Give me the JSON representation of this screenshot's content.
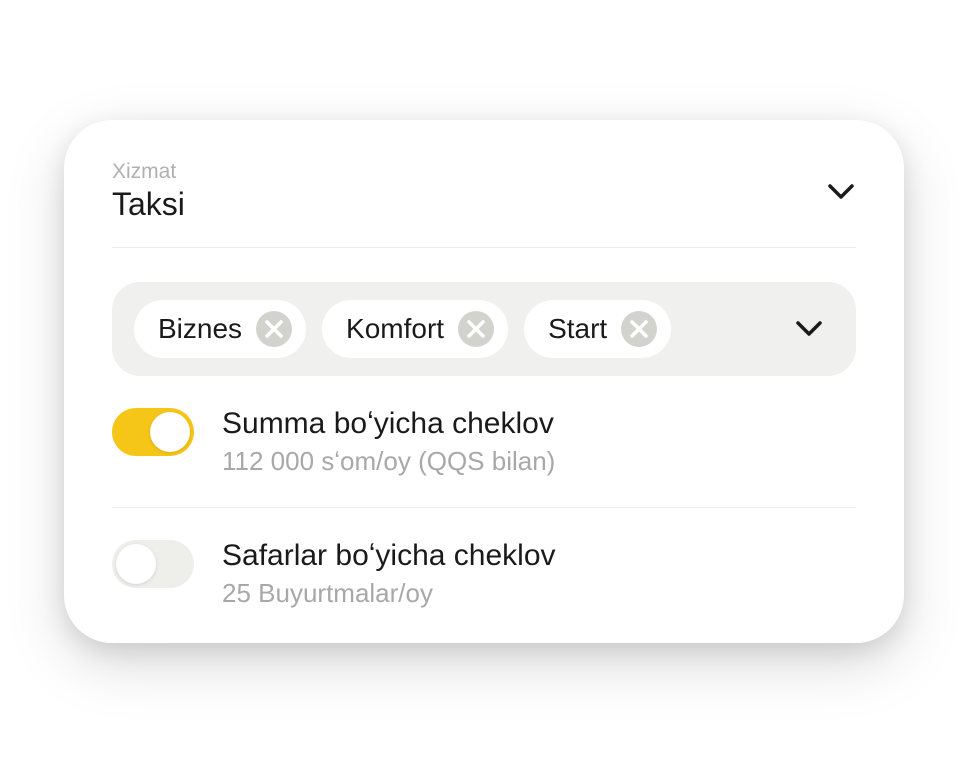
{
  "service": {
    "label": "Xizmat",
    "value": "Taksi"
  },
  "tags": [
    {
      "label": "Biznes"
    },
    {
      "label": "Komfort"
    },
    {
      "label": "Start"
    }
  ],
  "limits": {
    "amount": {
      "title": "Summa boʻyicha cheklov",
      "subtitle": "112 000 sʻom/oy (QQS bilan)",
      "enabled": true
    },
    "trips": {
      "title": "Safarlar boʻyicha cheklov",
      "subtitle": "25 Buyurtmalar/oy",
      "enabled": false
    }
  }
}
